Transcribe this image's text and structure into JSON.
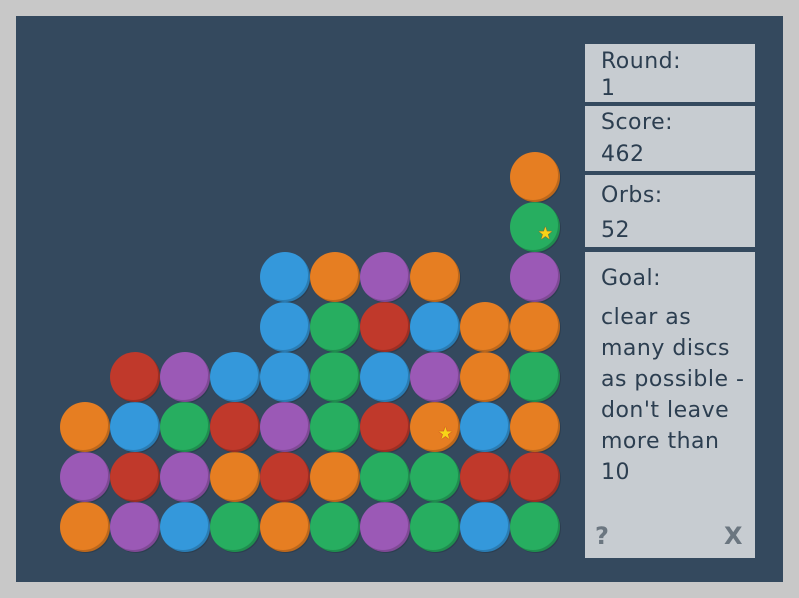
{
  "colors": {
    "orange": "#e67e22",
    "blue": "#3498db",
    "purple": "#9b59b6",
    "green": "#27ae60",
    "red": "#c0392b",
    "board": "#34495e"
  },
  "panel": {
    "round_label": "Round:",
    "round_value": "1",
    "score_label": "Score:",
    "score_value": "462",
    "orbs_label": "Orbs:",
    "orbs_value": "52",
    "goal_label": "Goal:",
    "goal_text": "clear as many discs as possible - don't leave more than 10",
    "help_label": "?",
    "close_label": "X"
  },
  "grid": {
    "columns": 10,
    "note_rows": "rows listed bottom-to-top; columns left-to-right; null = empty",
    "rows": [
      [
        "orange",
        "purple",
        "blue",
        "green",
        "orange",
        "green",
        "purple",
        "green",
        "blue",
        "green"
      ],
      [
        "purple",
        "red",
        "purple",
        "orange",
        "red",
        "orange",
        "green",
        "green",
        "red",
        "red"
      ],
      [
        "orange",
        "blue",
        "green",
        "red",
        "purple",
        "green",
        "red",
        "orange*",
        "blue",
        "orange"
      ],
      [
        null,
        "red",
        "purple",
        "blue",
        "blue",
        "green",
        "blue",
        "purple",
        "orange",
        "green"
      ],
      [
        null,
        null,
        null,
        null,
        "blue",
        "green",
        "red",
        "blue",
        "orange",
        "orange"
      ],
      [
        null,
        null,
        null,
        null,
        "blue",
        "orange",
        "purple",
        "orange",
        null,
        "purple"
      ],
      [
        null,
        null,
        null,
        null,
        null,
        null,
        null,
        null,
        null,
        "green*"
      ],
      [
        null,
        null,
        null,
        null,
        null,
        null,
        null,
        null,
        null,
        "orange"
      ]
    ]
  }
}
